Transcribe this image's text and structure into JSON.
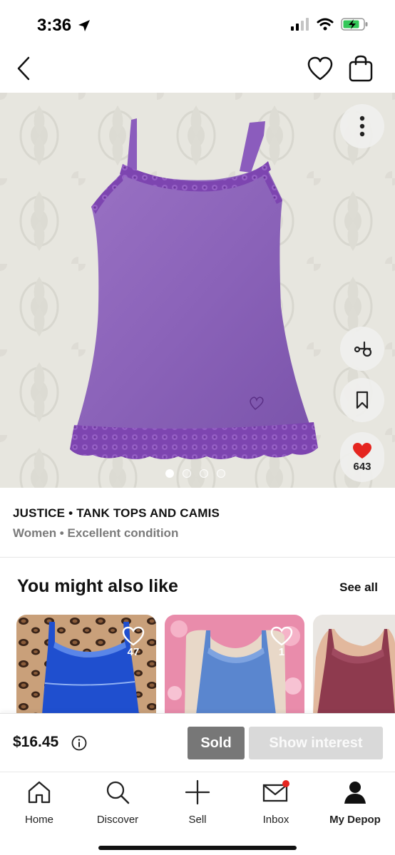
{
  "status_bar": {
    "time": "3:36",
    "icons": [
      "location-arrow-icon",
      "cellular-signal-icon",
      "wifi-icon",
      "battery-charging-icon"
    ],
    "battery_color": "#34c759"
  },
  "header": {
    "icons": [
      "back-chevron-icon",
      "heart-outline-icon",
      "shopping-bag-icon"
    ]
  },
  "hero": {
    "image_description": "purple lace-trim cami on white textured fabric",
    "like_count": "643",
    "like_color": "#e5251f",
    "image_index": 1,
    "image_total": 4,
    "side_icons": [
      "more-vertical-icon",
      "scissors-icon",
      "bookmark-icon",
      "heart-filled-icon"
    ]
  },
  "product": {
    "brand_category": "JUSTICE • TANK TOPS AND CAMIS",
    "meta": "Women • Excellent condition"
  },
  "recommendations": {
    "title": "You might also like",
    "see_all": "See all",
    "items": [
      {
        "like_count": "47"
      },
      {
        "like_count": "1"
      },
      {
        "like_count": ""
      }
    ]
  },
  "purchase": {
    "price": "$16.45",
    "sold_label": "Sold",
    "interest_label": "Show interest"
  },
  "tabs": [
    {
      "label": "Home",
      "icon": "home-icon"
    },
    {
      "label": "Discover",
      "icon": "search-icon"
    },
    {
      "label": "Sell",
      "icon": "plus-icon"
    },
    {
      "label": "Inbox",
      "icon": "mail-icon",
      "badge_color": "#e5251f"
    },
    {
      "label": "My Depop",
      "icon": "profile-icon",
      "active": true
    }
  ]
}
